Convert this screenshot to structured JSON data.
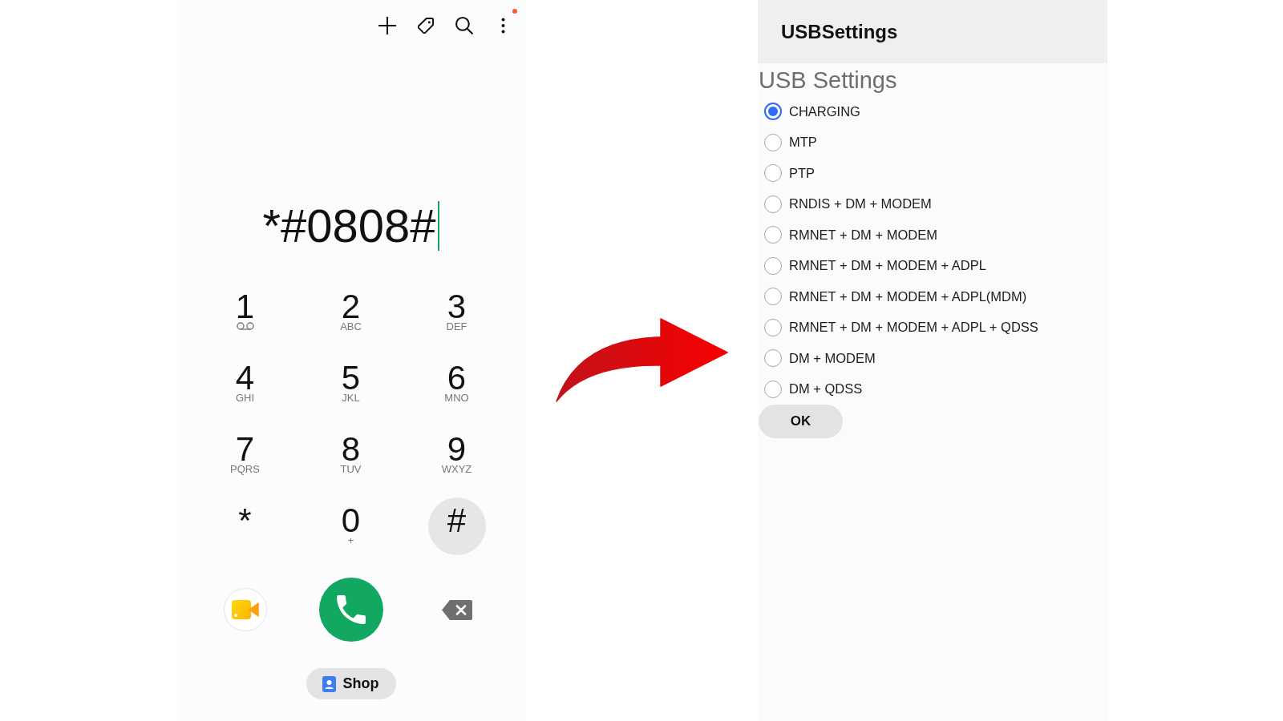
{
  "dialer": {
    "menu_badge": true,
    "number": "*#0808#",
    "keys": [
      {
        "digit": "1",
        "kind": "voicemail",
        "pressed": false
      },
      {
        "digit": "2",
        "kind": "letters",
        "letters": "ABC",
        "pressed": false
      },
      {
        "digit": "3",
        "kind": "letters",
        "letters": "DEF",
        "pressed": false
      },
      {
        "digit": "4",
        "kind": "letters",
        "letters": "GHI",
        "pressed": false
      },
      {
        "digit": "5",
        "kind": "letters",
        "letters": "JKL",
        "pressed": false
      },
      {
        "digit": "6",
        "kind": "letters",
        "letters": "MNO",
        "pressed": false
      },
      {
        "digit": "7",
        "kind": "letters",
        "letters": "PQRS",
        "pressed": false
      },
      {
        "digit": "8",
        "kind": "letters",
        "letters": "TUV",
        "pressed": false
      },
      {
        "digit": "9",
        "kind": "letters",
        "letters": "WXYZ",
        "pressed": false
      },
      {
        "digit": "*",
        "kind": "plain",
        "pressed": false
      },
      {
        "digit": "0",
        "kind": "letters",
        "letters": "+",
        "pressed": false
      },
      {
        "digit": "#",
        "kind": "plain",
        "pressed": true
      }
    ],
    "shop_label": "Shop"
  },
  "usb_settings": {
    "title": "USBSettings",
    "heading": "USB Settings",
    "options": [
      {
        "label": "CHARGING",
        "selected": true
      },
      {
        "label": "MTP",
        "selected": false
      },
      {
        "label": "PTP",
        "selected": false
      },
      {
        "label": "RNDIS + DM + MODEM",
        "selected": false
      },
      {
        "label": "RMNET + DM + MODEM",
        "selected": false
      },
      {
        "label": "RMNET + DM + MODEM + ADPL",
        "selected": false
      },
      {
        "label": "RMNET + DM + MODEM + ADPL(MDM)",
        "selected": false
      },
      {
        "label": "RMNET + DM + MODEM + ADPL + QDSS",
        "selected": false
      },
      {
        "label": "DM + MODEM",
        "selected": false
      },
      {
        "label": "DM + QDSS",
        "selected": false
      }
    ],
    "ok_label": "OK"
  }
}
